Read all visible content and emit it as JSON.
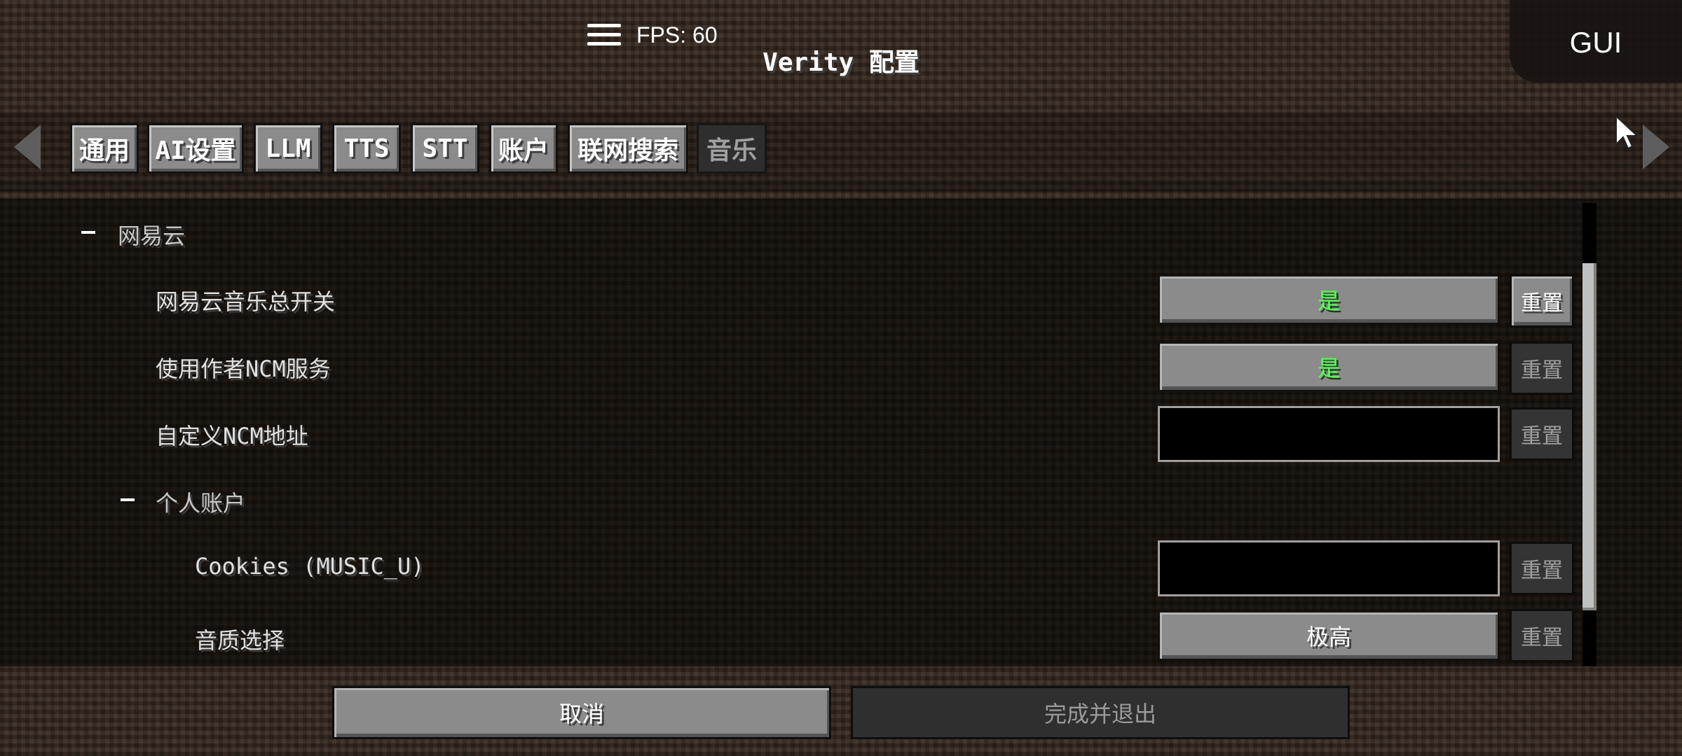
{
  "overlay": {
    "fps_text": "FPS: 60",
    "gui_label": "GUI"
  },
  "header": {
    "title": "Verity 配置"
  },
  "tabs": [
    {
      "label": "通用",
      "active": false
    },
    {
      "label": "AI设置",
      "active": false
    },
    {
      "label": "LLM",
      "active": false
    },
    {
      "label": "TTS",
      "active": false
    },
    {
      "label": "STT",
      "active": false
    },
    {
      "label": "账户",
      "active": false
    },
    {
      "label": "联网搜索",
      "active": false
    },
    {
      "label": "音乐",
      "active": true
    }
  ],
  "settings": {
    "section_netease": "网易云",
    "rows": [
      {
        "label": "网易云音乐总开关",
        "value": "是",
        "reset": "重置"
      },
      {
        "label": "使用作者NCM服务",
        "value": "是",
        "reset": "重置"
      },
      {
        "label": "自定义NCM地址",
        "value": "",
        "reset": "重置"
      },
      {
        "label": "Cookies (MUSIC_U)",
        "value": "",
        "reset": "重置"
      },
      {
        "label": "音质选择",
        "value": "极高",
        "reset": "重置"
      }
    ],
    "section_account": "个人账户"
  },
  "footer": {
    "cancel_label": "取消",
    "done_label": "完成并退出"
  },
  "colors": {
    "enabled_true": "#55ff55",
    "button_gray": "#8b8b8b",
    "disabled_gray": "#2f2f2f"
  }
}
